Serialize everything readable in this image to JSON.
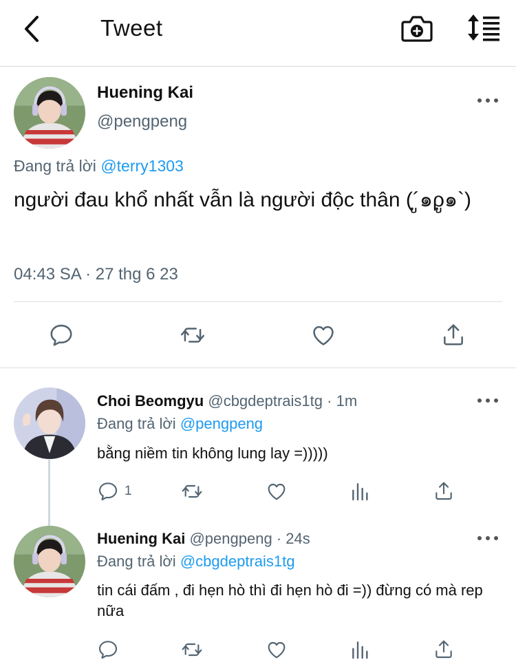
{
  "header": {
    "title": "Tweet",
    "back_icon": "chevron-left-icon",
    "camera_icon": "camera-plus-icon",
    "sort_icon": "sort-list-icon"
  },
  "main_tweet": {
    "name": "Huening Kai",
    "handle": "@pengpeng",
    "replying_prefix": "Đang trả lời",
    "replying_to": "@terry1303",
    "text": "người đau khổ nhất vẫn là người độc thân (´ູ๑ρູ๑`)",
    "timestamp": "04:43 SA · 27 thg 6 23"
  },
  "replies": [
    {
      "name": "Choi Beomgyu",
      "handle": "@cbgdeptrais1tg",
      "time": "· 1m",
      "replying_prefix": "Đang trả lời",
      "replying_to": "@pengpeng",
      "text": "bằng niềm tin không lung lay =)))))",
      "reply_count": "1"
    },
    {
      "name": "Huening Kai",
      "handle": "@pengpeng",
      "time": "· 24s",
      "replying_prefix": "Đang trả lời",
      "replying_to": "@cbgdeptrais1tg",
      "text": "tin cái đấm , đi hẹn hò thì đi hẹn hò đi =)) đừng có mà rep nữa"
    }
  ],
  "colors": {
    "link": "#1d9bf0",
    "secondary_text": "#536471",
    "icon": "#536471"
  }
}
